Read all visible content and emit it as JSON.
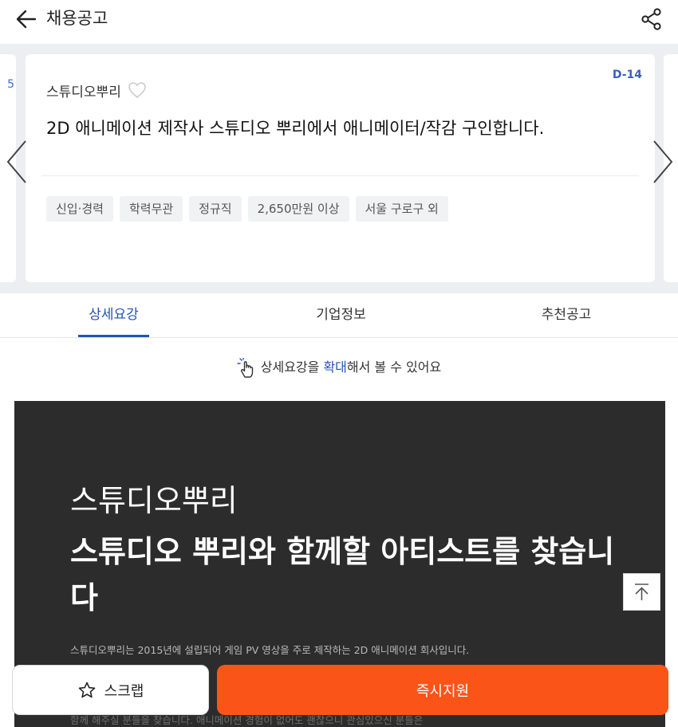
{
  "header": {
    "title": "채용공고",
    "back_icon": "arrow-left-icon",
    "share_icon": "share-icon"
  },
  "carousel": {
    "prev_card_peek": "5",
    "card": {
      "company": "스튜디오뿌리",
      "dday": "D-14",
      "title": "2D 애니메이션 제작사 스튜디오 뿌리에서 애니메이터/작감 구인합니다.",
      "tags": [
        "신입·경력",
        "학력무관",
        "정규직",
        "2,650만원 이상",
        "서울 구로구 외"
      ]
    }
  },
  "tabs": [
    {
      "label": "상세요강",
      "active": true
    },
    {
      "label": "기업정보",
      "active": false
    },
    {
      "label": "추천공고",
      "active": false
    }
  ],
  "hint": {
    "before": "상세요강을 ",
    "emphasis": "확대",
    "after": "해서 볼 수 있어요"
  },
  "detail": {
    "company": "스튜디오뿌리",
    "headline": "스튜디오 뿌리와 함께할 아티스트를 찾습니다",
    "body_line1": "스튜디오뿌리는 2015년에 설립되어 게임 PV 영상을 주로 제작하는 2D 애니메이션 회사입니다.",
    "body_line_last": "함께 해주실 분들을 찾습니다. 애니메이션 경험이 없어도 괜찮으니 관심있으신 분들은"
  },
  "bottom_bar": {
    "scrap_label": "스크랩",
    "apply_label": "즉시지원"
  },
  "colors": {
    "accent_blue": "#2453b5",
    "apply_orange": "#fb5419",
    "detail_bg": "#2d2c2d"
  }
}
